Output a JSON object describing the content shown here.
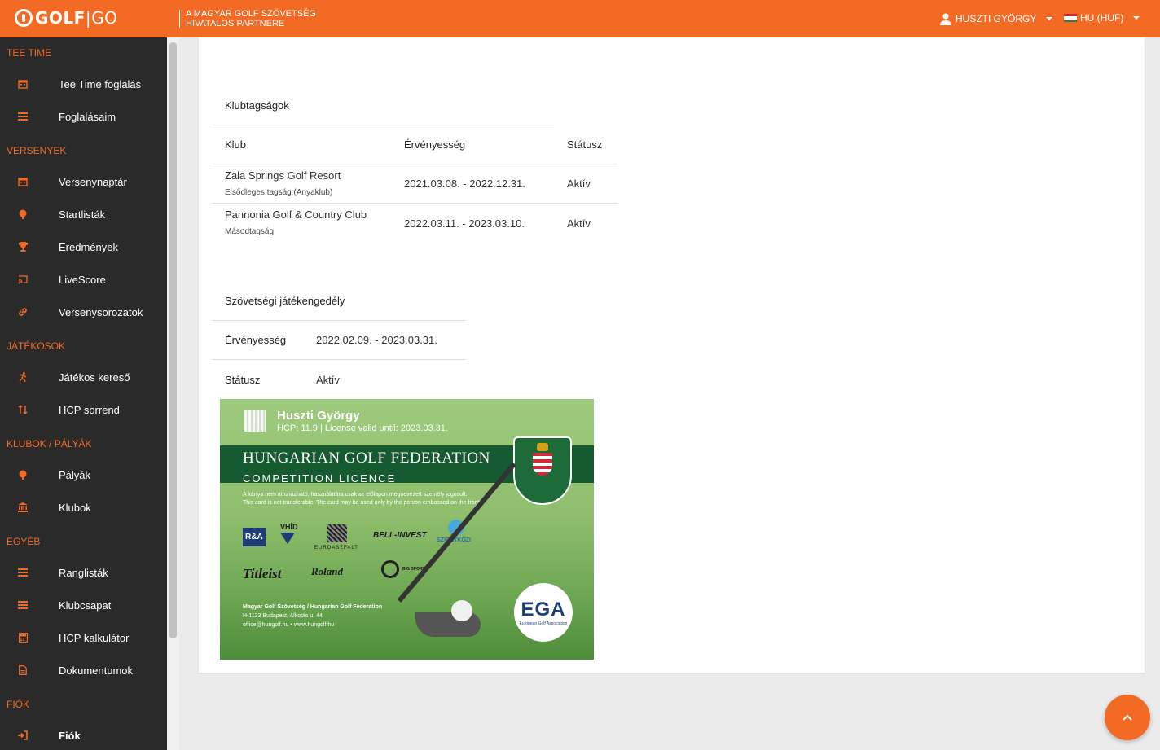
{
  "brand": {
    "logo_bold": "GOLF",
    "logo_thin": "GO",
    "partner_line1": "A MAGYAR GOLF SZÖVETSÉG",
    "partner_line2": "HIVATALOS PARTNERE",
    "accent_color": "#f26a24"
  },
  "header": {
    "user_name": "HUSZTI GYÖRGY",
    "language": "HU (HUF)",
    "user_icon": "user-icon",
    "flag_icon": "hungary-flag-icon"
  },
  "sidebar": {
    "sections": [
      {
        "title": "TEE TIME",
        "items": [
          {
            "label": "Tee Time foglalás",
            "icon": "calendar-icon"
          },
          {
            "label": "Foglalásaim",
            "icon": "list-icon"
          }
        ]
      },
      {
        "title": "VERSENYEK",
        "items": [
          {
            "label": "Versenynaptár",
            "icon": "calendar-icon"
          },
          {
            "label": "Startlisták",
            "icon": "golf-ball-icon"
          },
          {
            "label": "Eredmények",
            "icon": "trophy-icon"
          },
          {
            "label": "LiveScore",
            "icon": "cast-icon"
          },
          {
            "label": "Versenysorozatok",
            "icon": "link-icon"
          }
        ]
      },
      {
        "title": "JÁTÉKOSOK",
        "items": [
          {
            "label": "Játékos kereső",
            "icon": "running-icon"
          },
          {
            "label": "HCP sorrend",
            "icon": "sort-icon"
          }
        ]
      },
      {
        "title": "KLUBOK / PÁLYÁK",
        "items": [
          {
            "label": "Pályák",
            "icon": "golf-ball-icon"
          },
          {
            "label": "Klubok",
            "icon": "bank-icon"
          }
        ]
      },
      {
        "title": "EGYÉB",
        "items": [
          {
            "label": "Ranglisták",
            "icon": "list-ordered-icon"
          },
          {
            "label": "Klubcsapat",
            "icon": "list-ordered-icon"
          },
          {
            "label": "HCP kalkulátor",
            "icon": "calculator-icon"
          },
          {
            "label": "Dokumentumok",
            "icon": "document-icon"
          }
        ]
      },
      {
        "title": "FIÓK",
        "items": [
          {
            "label": "Fiók",
            "icon": "sign-in-icon"
          }
        ]
      }
    ]
  },
  "memberships": {
    "title": "Klubtagságok",
    "headers": {
      "club": "Klub",
      "validity": "Érvényesség",
      "status": "Státusz"
    },
    "rows": [
      {
        "club": "Zala Springs Golf Resort",
        "sub": "Elsődleges tagság (Anyaklub)",
        "validity": "2021.03.08. - 2022.12.31.",
        "status": "Aktív"
      },
      {
        "club": "Pannonia Golf & Country Club",
        "sub": "Másodtagság",
        "validity": "2022.03.11. - 2023.03.10.",
        "status": "Aktív"
      }
    ]
  },
  "license": {
    "title": "Szövetségi játékengedély",
    "validity_label": "Érvényesség",
    "validity_value": "2022.02.09. - 2023.03.31.",
    "status_label": "Státusz",
    "status_value": "Aktív"
  },
  "license_card": {
    "name": "Huszti György",
    "hcp_line": "HCP: 11.9 | License valid until: 2023.03.31.",
    "federation": "HUNGARIAN GOLF FEDERATION",
    "competition": "COMPETITION LICENCE",
    "note_hu": "A kártya nem átruházható, használatára csak az előlapon megnevezett személy jogosult.",
    "note_en": "This card is not transferable. The card may be used only by the person embossed on the front.",
    "sponsors": [
      "R&A",
      "VHÍD",
      "EUROASZFALT",
      "BELL-INVEST",
      "SZIGETKÖZI",
      "Titleist",
      "Roland",
      "BIG SPORT"
    ],
    "footer1": "Magyar Golf Szövetség / Hungarian Golf Federation",
    "footer2": "H-1123 Budapest, Alkotás u. 44.",
    "footer3": "office@hungolf.hu • www.hungolf.hu",
    "ega": "EGA",
    "ega_sub": "European Golf Association"
  },
  "scroll_top_icon": "chevron-up-icon"
}
